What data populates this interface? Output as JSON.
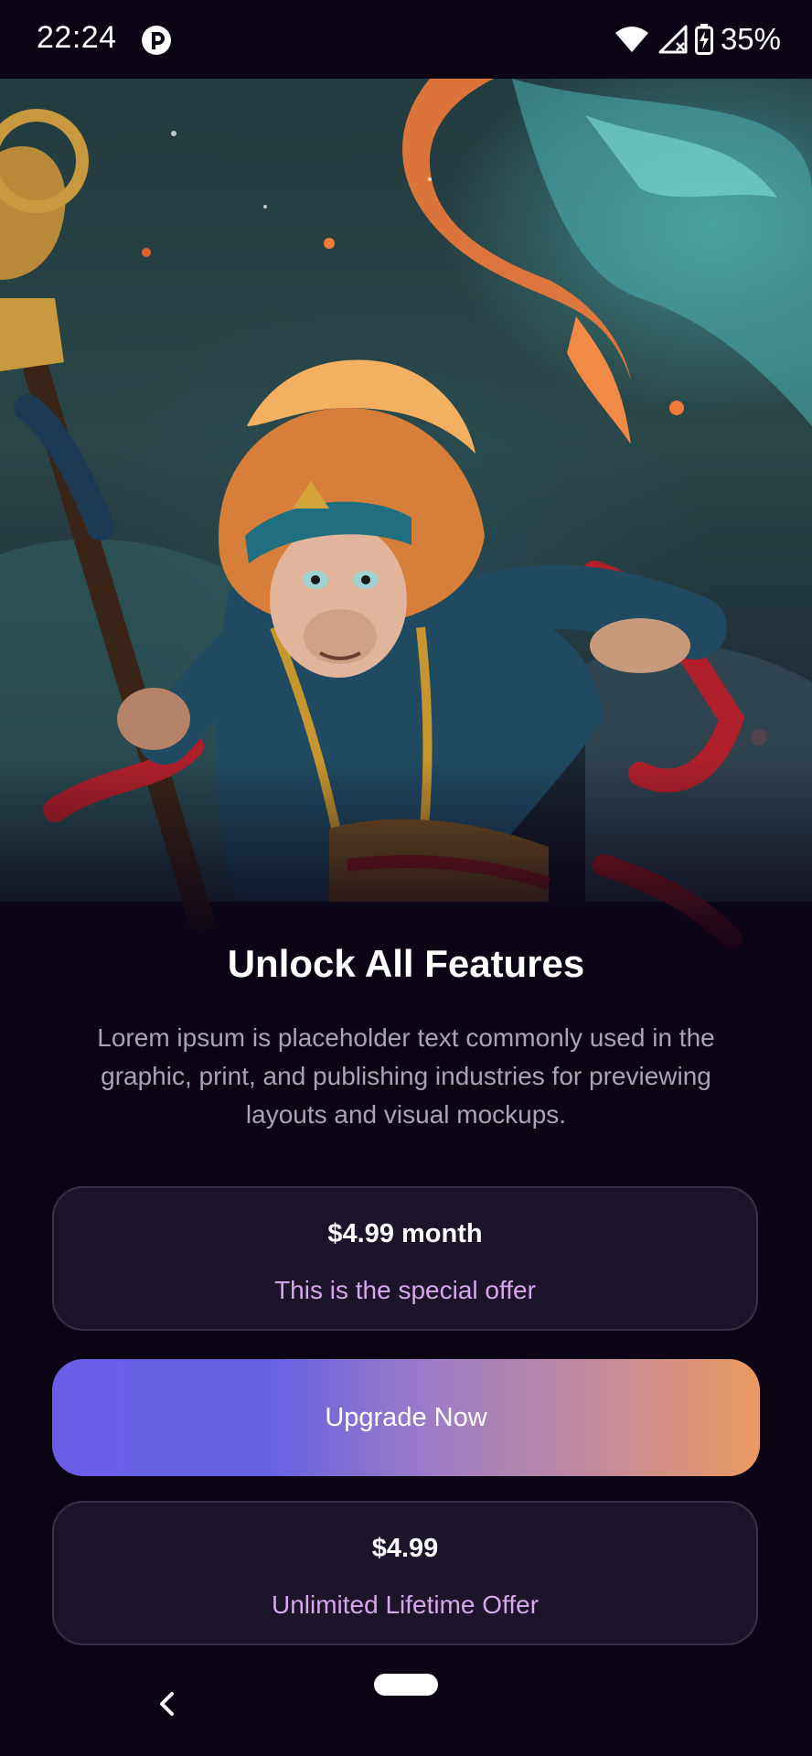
{
  "status_bar": {
    "time": "22:24",
    "battery_text": "35%",
    "icons": [
      "app-notification-icon",
      "wifi-icon",
      "cellular-no-signal-icon",
      "battery-charging-icon"
    ]
  },
  "hero": {
    "image_subject": "monkey-king-artwork"
  },
  "paywall": {
    "title": "Unlock All Features",
    "description": "Lorem ipsum is placeholder text commonly used in the graphic, print, and publishing industries for previewing layouts and visual mockups.",
    "plans": [
      {
        "price": "$4.99 month",
        "subtitle": "This is the special offer"
      },
      {
        "price": "$4.99",
        "subtitle": "Unlimited Lifetime Offer"
      }
    ],
    "upgrade_label": "Upgrade Now"
  },
  "colors": {
    "background": "#0b0415",
    "card": "#1c1429",
    "accent_text": "#d6a7ee",
    "gradient_start": "#6b5ee6",
    "gradient_end": "#eb9a5f"
  },
  "nav": {
    "icons": [
      "back-icon",
      "home-pill-icon"
    ]
  }
}
